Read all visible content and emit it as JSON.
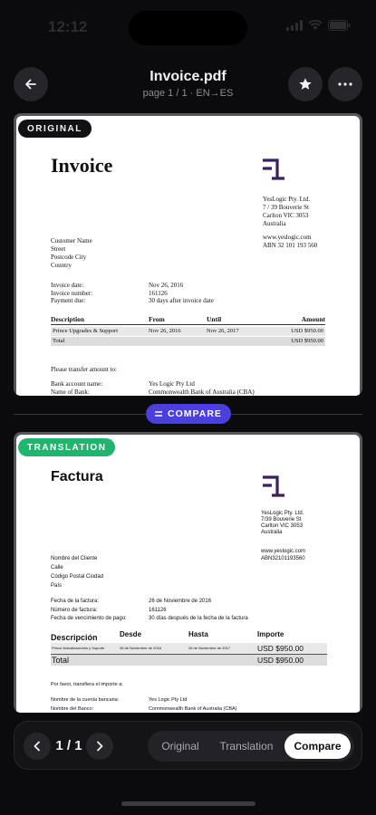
{
  "status": {
    "time": "12:12"
  },
  "header": {
    "title": "Invoice.pdf",
    "subtitle": "page 1 / 1 · EN→ES"
  },
  "badges": {
    "original": "ORIGINAL",
    "translation": "TRANSLATION"
  },
  "compare_divider": {
    "label": "COMPARE"
  },
  "original_doc": {
    "heading": "Invoice",
    "company": [
      "YesLogic Pty. Ltd.",
      "7 / 39 Bouverie St",
      "Carlton VIC 3053",
      "Australia"
    ],
    "web": "www.yeslogic.com",
    "abn": "ABN 32 101 193 560",
    "customer": [
      "Customer Name",
      "Street",
      "Postcode City",
      "Country"
    ],
    "meta": [
      {
        "label": "Invoice date:",
        "value": "Nov 26, 2016"
      },
      {
        "label": "Invoice number:",
        "value": "161126"
      },
      {
        "label": "Payment due:",
        "value": "30 days after invoice date"
      }
    ],
    "table_headers": [
      "Description",
      "From",
      "Until",
      "Amount"
    ],
    "row": [
      "Prince Upgrades & Support",
      "Nov 26, 2016",
      "Nov 26, 2017",
      "USD $950.00"
    ],
    "total_label": "Total",
    "total_value": "USD $950.00",
    "transfer_note": "Please transfer amount to:",
    "bank": [
      {
        "label": "Bank account name:",
        "value": "Yes Logic Pty Ltd"
      },
      {
        "label": "Name of Bank:",
        "value": "Commonwealth Bank of Australia (CBA)"
      }
    ]
  },
  "translated_doc": {
    "heading": "Factura",
    "company": [
      "YesLogic Pty. Ltd.",
      "7/39 Bouverie St",
      "Carlton VIC 3053",
      "Australia"
    ],
    "web": "www.yeslogic.com",
    "abn": "ABN32101193560",
    "customer": [
      "Nombre del Cliente",
      "Calle",
      "Código Postal Ciudad",
      "País"
    ],
    "meta": [
      {
        "label": "Fecha de la factura:",
        "value": "26 de Noviembre de 2016"
      },
      {
        "label": "Número de factura:",
        "value": "161126"
      },
      {
        "label": "Fecha de vencimiento de pago:",
        "value": "30 días después de la fecha de la factura"
      }
    ],
    "table_headers": [
      "Descripción",
      "Desde",
      "Hasta",
      "Importe"
    ],
    "row": [
      "Prince Actualizaciones y Soporte",
      "26 de Noviembre de 2016",
      "26 de Noviembre de 2017",
      "USD $950.00"
    ],
    "total_label": "Total",
    "total_value": "USD $950.00",
    "transfer_note": "Por favor, transfiera el importe a:",
    "bank": [
      {
        "label": "Nombre de la cuenta bancaria:",
        "value": "Yes Logic Pty Ltd"
      },
      {
        "label": "Nombre del Banco:",
        "value": "Commonwealth Bank of Australia (CBA)"
      }
    ]
  },
  "bottom_bar": {
    "page_indicator": "1 / 1",
    "segments": [
      "Original",
      "Translation",
      "Compare"
    ],
    "active_segment": "Compare"
  },
  "colors": {
    "accent": "#4c3fe0",
    "translation_badge": "#1fb56e",
    "logo": "#3b1f5e"
  },
  "icons": [
    "back-arrow-icon",
    "star-icon",
    "more-icon",
    "chevron-left-icon",
    "chevron-right-icon",
    "compare-icon",
    "logo-icon"
  ]
}
